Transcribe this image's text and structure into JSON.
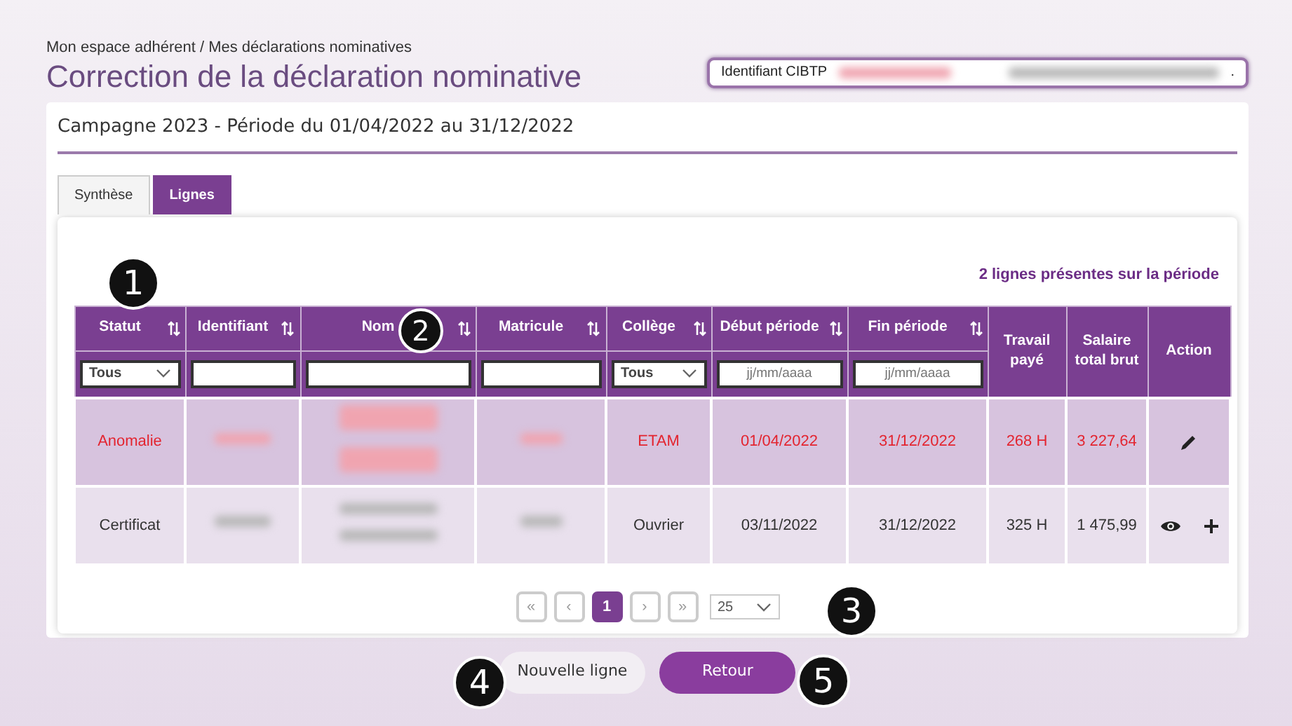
{
  "breadcrumb": "Mon espace adhérent / Mes déclarations nominatives",
  "title": "Correction de la déclaration nominative",
  "identifier": {
    "label": "Identifiant CIBTP",
    "redacted": true,
    "suffix": "."
  },
  "campaign": "Campagne 2023 - Période du 01/04/2022 au 31/12/2022",
  "tabs": [
    {
      "label": "Synthèse",
      "selected": false
    },
    {
      "label": "Lignes",
      "selected": true
    }
  ],
  "count": "2 lignes présentes sur la période",
  "table": {
    "columns": [
      {
        "label": "Statut",
        "sortable": true,
        "filter": {
          "kind": "select",
          "value": "Tous"
        }
      },
      {
        "label": "Identifiant",
        "sortable": true,
        "filter": {
          "kind": "text"
        }
      },
      {
        "label": "Nom",
        "sortable": true,
        "filter": {
          "kind": "text"
        }
      },
      {
        "label": "Matricule",
        "sortable": true,
        "filter": {
          "kind": "text"
        }
      },
      {
        "label": "Collège",
        "sortable": true,
        "filter": {
          "kind": "select",
          "value": "Tous"
        }
      },
      {
        "label": "Début période",
        "sortable": true,
        "filter": {
          "kind": "date",
          "placeholder": "jj/mm/aaaa"
        }
      },
      {
        "label": "Fin période",
        "sortable": true,
        "filter": {
          "kind": "date",
          "placeholder": "jj/mm/aaaa"
        }
      },
      {
        "label": "Travail payé"
      },
      {
        "label": "Salaire total brut"
      },
      {
        "label": "Action"
      }
    ],
    "rows": [
      {
        "anomaly": true,
        "cells": [
          {
            "text": "Anomalie"
          },
          {
            "redacted": true
          },
          {
            "redacted": true
          },
          {
            "redacted": true
          },
          {
            "text": "ETAM"
          },
          {
            "text": "01/04/2022"
          },
          {
            "text": "31/12/2022"
          },
          {
            "text": "268 H"
          },
          {
            "text": "3 227,64"
          }
        ],
        "actions": [
          {
            "kind": "edit"
          }
        ]
      },
      {
        "anomaly": false,
        "cells": [
          {
            "text": "Certificat"
          },
          {
            "redacted": true
          },
          {
            "redacted": true
          },
          {
            "redacted": true
          },
          {
            "text": "Ouvrier"
          },
          {
            "text": "03/11/2022"
          },
          {
            "text": "31/12/2022"
          },
          {
            "text": "325 H"
          },
          {
            "text": "1 475,99"
          }
        ],
        "actions": [
          {
            "kind": "view"
          },
          {
            "kind": "add"
          }
        ]
      }
    ]
  },
  "pagination": {
    "buttons": [
      {
        "label": "«",
        "selected": false
      },
      {
        "label": "‹",
        "selected": false
      },
      {
        "label": "1",
        "selected": true
      },
      {
        "label": "›",
        "selected": false
      },
      {
        "label": "»",
        "selected": false
      }
    ],
    "page_size": "25"
  },
  "buttons": [
    {
      "label": "Nouvelle ligne",
      "kind": "secondary"
    },
    {
      "label": "Retour",
      "kind": "primary"
    }
  ],
  "callouts": [
    "1",
    "2",
    "3",
    "4",
    "5"
  ]
}
